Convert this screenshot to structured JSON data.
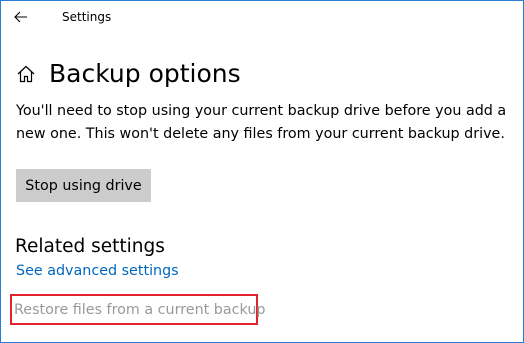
{
  "window": {
    "title": "Settings",
    "accent_border_color": "#2b7cd3"
  },
  "titlebar": {
    "back_icon": "back-arrow-icon"
  },
  "page": {
    "icon": "home-icon",
    "title": "Backup options",
    "description": "You'll need to stop using your current backup drive before you add a new one. This won't delete any files from your current backup drive."
  },
  "actions": {
    "stop_label": "Stop using drive"
  },
  "related": {
    "heading": "Related settings",
    "advanced_link": "See advanced settings",
    "restore_link": "Restore files from a current backup",
    "highlight_color": "#e0232e"
  },
  "colors": {
    "link": "#0067c0",
    "disabled_text": "#999999",
    "button_bg": "#cccccc"
  }
}
